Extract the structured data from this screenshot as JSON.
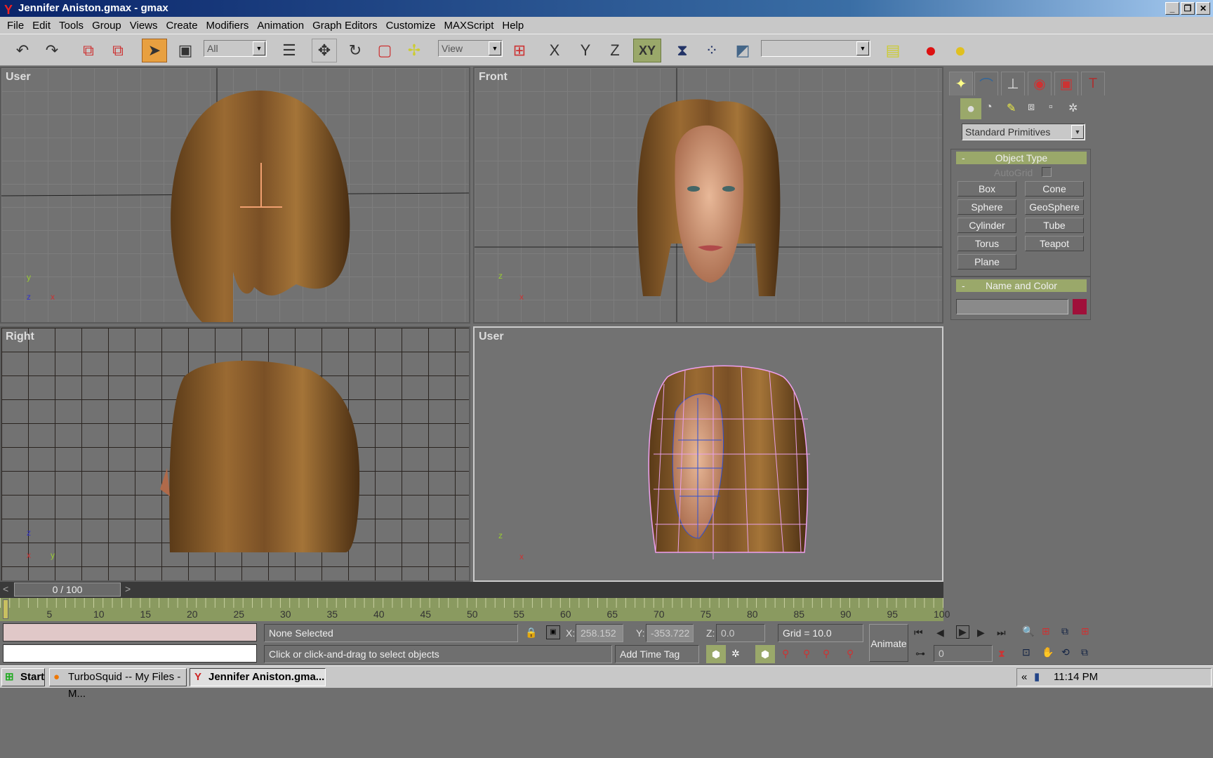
{
  "window": {
    "title": "Jennifer Aniston.gmax - gmax",
    "controls": [
      "_",
      "❐",
      "✕"
    ]
  },
  "menu": [
    "File",
    "Edit",
    "Tools",
    "Group",
    "Views",
    "Create",
    "Modifiers",
    "Animation",
    "Graph Editors",
    "Customize",
    "MAXScript",
    "Help"
  ],
  "toolbar": {
    "selection_filter": "All",
    "reference_coord": "View",
    "named_selection": "",
    "axis": [
      "X",
      "Y",
      "Z",
      "XY"
    ]
  },
  "viewports": [
    {
      "label": "User"
    },
    {
      "label": "Front"
    },
    {
      "label": "Right"
    },
    {
      "label": "User"
    }
  ],
  "command_panel": {
    "category": "Standard Primitives",
    "object_type": {
      "title": "Object Type",
      "autogrid": "AutoGrid",
      "buttons": [
        "Box",
        "Cone",
        "Sphere",
        "GeoSphere",
        "Cylinder",
        "Tube",
        "Torus",
        "Teapot",
        "Plane"
      ]
    },
    "name_color": {
      "title": "Name and Color",
      "name": "",
      "color": "#a0103a"
    },
    "collapse": "-"
  },
  "timeline": {
    "frame": "0 / 100",
    "current": 0,
    "total": 100,
    "ticks": [
      "5",
      "10",
      "15",
      "20",
      "25",
      "30",
      "35",
      "40",
      "45",
      "50",
      "55",
      "60",
      "65",
      "70",
      "75",
      "80",
      "85",
      "90",
      "95",
      "100"
    ],
    "prev": "<",
    "next": ">"
  },
  "status": {
    "selection": "None Selected",
    "prompt": "Click or click-and-drag to select objects",
    "x_label": "X:",
    "x": "258.152",
    "y_label": "Y:",
    "y": "-353.722",
    "z_label": "Z:",
    "z": "0.0",
    "grid": "Grid = 10.0",
    "animate": "Animate",
    "add_time_tag": "Add Time Tag",
    "frame_field": "0"
  },
  "taskbar": {
    "start": "Start",
    "tasks": [
      "TurboSquid -- My Files - M...",
      "Jennifer Aniston.gma..."
    ],
    "clock": "11:14 PM",
    "tray_expand": "«"
  }
}
